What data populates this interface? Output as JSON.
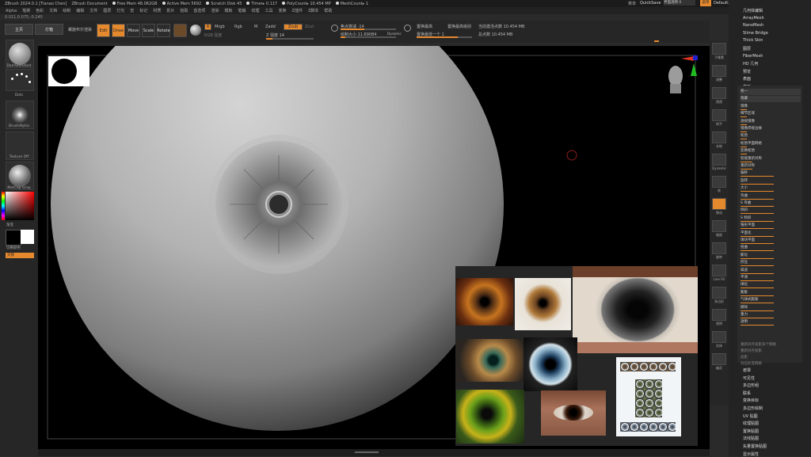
{
  "titlebar": {
    "app": "ZBrush 2024.0.1 [Tianao Chen]",
    "doc": "ZBrush Document",
    "items": [
      "Free Mem 48.062GB",
      "Active Mem 5692",
      "Scratch Disk 45",
      "Timer▸ 0.117",
      "PolyCount▸ 10.454 MP",
      "MeshCount▸ 1"
    ],
    "right_menus": "菜单",
    "quicksave": "QuickSave",
    "transparency": "界面透明 0",
    "layout_btn": "菜单",
    "script": "DefaultZScript"
  },
  "menubar": [
    "Alpha",
    "笔刷",
    "色彩",
    "文档",
    "绘制",
    "编辑",
    "文件",
    "图层",
    "灯光",
    "宏",
    "标记",
    "材质",
    "影片",
    "拾取",
    "首选项",
    "渲染",
    "模板",
    "笔触",
    "纹理",
    "工具",
    "变换",
    "Z插件",
    "Z脚本",
    "帮助"
  ],
  "coords": "0.011,0.075,-0.245",
  "toolbar": {
    "home": "主页",
    "lightbox": "灯箱",
    "live_boolean": "螺旋布尔渲染",
    "edit": "Edit",
    "draw": "Draw",
    "move": "Move",
    "scale": "Scale",
    "rotate": "Rotate",
    "a": "A",
    "mrgb": "Mrgb",
    "rgb": "Rgb",
    "m": "M",
    "zadd": "Zadd",
    "zsub": "Zsub",
    "zcut": "Zcut",
    "rgb_intensity": "RGB 强度",
    "z_intensity": "Z 强度 14",
    "focal_shift": "焦点衰减 -14",
    "draw_size": "绘制大小 11.69084",
    "dynamic": "Dynamic",
    "active_points": "当前激活点数 10.454 MB",
    "total_points": "总点数 10.454 MB",
    "subdiv_highest": "置换最高",
    "subdiv_next": "置换最低一个 1",
    "subdiv_highest_level": "置换最高级别"
  },
  "left_tray": {
    "brush": "DamStandard",
    "stroke": "Dots",
    "alpha": "BrushAlpha",
    "texture": "Texture Off",
    "material": "MatCap Gray",
    "gradient": "渐变",
    "switch_color": "切换颜色",
    "alternate": "交替"
  },
  "right_shelf": [
    "子像素",
    "调整",
    "透视",
    "地平",
    "本地",
    "Dynamic",
    "帧",
    "移动",
    "缩放",
    "旋转",
    "Line Fill",
    "多边形",
    "透明",
    "实体",
    "幽灵"
  ],
  "right_panel_top": [
    "几何体编辑",
    "ArrayMesh",
    "NanoMesh",
    "Slime Bridge",
    "Thick Skin",
    "图层",
    "FiberMesh",
    "HD 几何",
    "预览",
    "表面",
    "变形"
  ],
  "subpanel_rows": [
    {
      "label": "统一",
      "bar": 0
    },
    {
      "label": "隐藏",
      "bar": 0
    },
    {
      "label": "镜像",
      "bar": 0.1
    },
    {
      "label": "细节区域",
      "bar": 0.1
    },
    {
      "label": "透视镜像",
      "bar": 0.1
    },
    {
      "label": "镜像焊接边缘",
      "bar": 0.1
    },
    {
      "label": "松弛",
      "bar": 0.1
    },
    {
      "label": "松弛平面网格",
      "bar": 0.1
    },
    {
      "label": "变换松弛",
      "bar": 0.1
    },
    {
      "label": "智能重新对称",
      "bar": 0.2
    },
    {
      "label": "重新对称",
      "bar": 0.2
    },
    {
      "label": "偏移",
      "bar": 0.55
    },
    {
      "label": "旋转",
      "bar": 0.55
    },
    {
      "label": "大小",
      "bar": 0.55
    },
    {
      "label": "弯曲",
      "bar": 0.55
    },
    {
      "label": "S 弯曲",
      "bar": 0.55
    },
    {
      "label": "倾斜",
      "bar": 0.55
    },
    {
      "label": "S 倾斜",
      "bar": 0.55
    },
    {
      "label": "锥形平面",
      "bar": 0.55
    },
    {
      "label": "平面化",
      "bar": 0.55
    },
    {
      "label": "填块平面",
      "bar": 0.55
    },
    {
      "label": "扭曲",
      "bar": 0.55
    },
    {
      "label": "膨化",
      "bar": 0.55
    },
    {
      "label": "挤压",
      "bar": 0.55
    },
    {
      "label": "噪波",
      "bar": 0.55
    },
    {
      "label": "平滑",
      "bar": 0.55
    },
    {
      "label": "球化",
      "bar": 0.55
    },
    {
      "label": "膨胀",
      "bar": 0.55
    },
    {
      "label": "气球式膨胀",
      "bar": 0.55
    },
    {
      "label": "擦除",
      "bar": 0.55
    },
    {
      "label": "重力",
      "bar": 0.55
    },
    {
      "label": "透明",
      "bar": 0.55
    }
  ],
  "subpanel_footer": [
    "重新对齐投影多个网格",
    "重新对齐投影",
    "投影",
    "对应形变网格"
  ],
  "right_panel_bottom": [
    "遮罩",
    "可见性",
    "多边形组",
    "联系",
    "变换目标",
    "多边形绘制",
    "UV 贴图",
    "纹理贴图",
    "置换贴图",
    "法线贴图",
    "矢量置换贴图",
    "显示属性"
  ],
  "colors": {
    "accent": "#e5892e",
    "panel": "#262626",
    "viewport": "#000000"
  },
  "icons": [
    "mirror-icon",
    "head-nav-icon",
    "axis-gizmo-icon",
    "brush-cursor-icon"
  ]
}
